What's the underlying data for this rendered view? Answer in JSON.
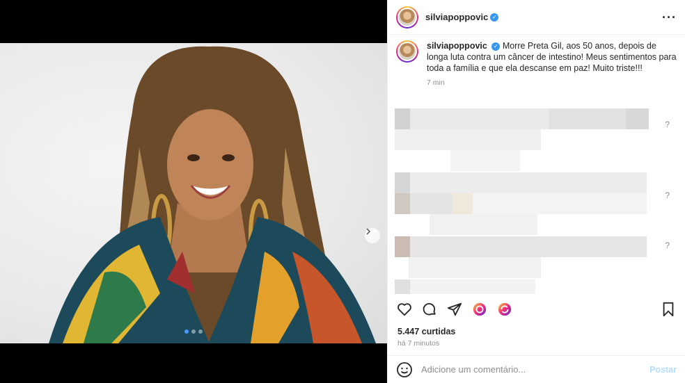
{
  "post": {
    "username": "silviapoppovic",
    "caption": "Morre Preta Gil, aos 50 anos, depois de longa luta contra um câncer de intestino! Meus sentimentos para toda a família e que ela descanse em paz! Muito triste!!!",
    "caption_time": "7 min",
    "likes": "5.447 curtidas",
    "posted_ago": "há 7 minutos",
    "carousel": {
      "count": 3,
      "active_index": 1
    }
  },
  "comment_box": {
    "placeholder": "Adicione um comentário...",
    "post_label": "Postar"
  },
  "icons": {
    "more": "more-options-icon",
    "verified": "verified-badge-icon",
    "like": "heart-icon",
    "comment": "comment-bubble-icon",
    "share": "paper-plane-icon",
    "remix": "remix-icon",
    "repost": "repost-icon",
    "save": "bookmark-icon",
    "emoji": "emoji-icon",
    "next": "chevron-right-icon"
  },
  "colors": {
    "accent": "#3897f0",
    "muted_text": "#8e8e8e",
    "post_button": "#b2dffc",
    "story_ring_start": "#f9ce34",
    "story_ring_mid": "#ee2a7b"
  }
}
